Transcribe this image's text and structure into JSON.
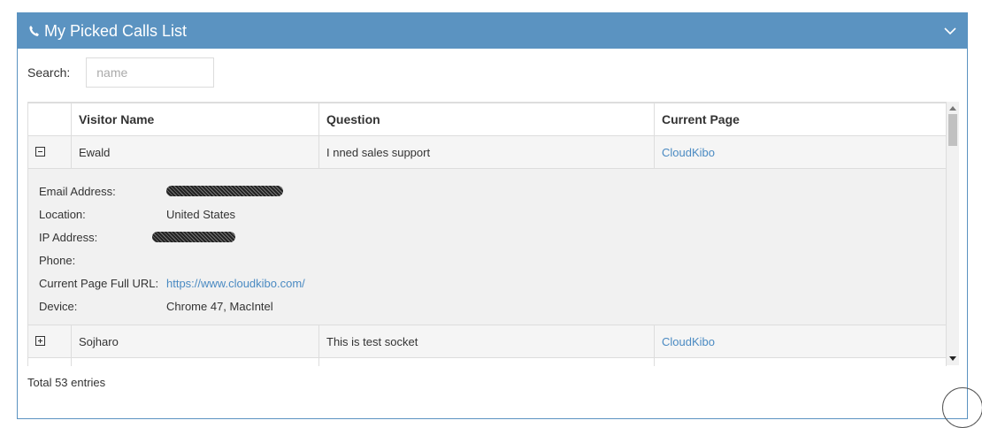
{
  "panel": {
    "title": "My Picked Calls List",
    "icons": {
      "title_icon": "phone-icon",
      "collapse": "chevron-down-icon"
    },
    "header_color": "#5b93c1"
  },
  "search": {
    "label": "Search:",
    "placeholder": "name",
    "value": ""
  },
  "table": {
    "columns": [
      "",
      "Visitor Name",
      "Question",
      "Current Page"
    ],
    "rows": [
      {
        "expanded": true,
        "visitor_name": "Ewald",
        "question": "I nned sales support",
        "current_page": "CloudKibo"
      },
      {
        "expanded": false,
        "visitor_name": "Sojharo",
        "question": "This is test socket",
        "current_page": "CloudKibo"
      }
    ],
    "details": {
      "email_label": "Email Address:",
      "location_label": "Location:",
      "location": "United States",
      "ip_label": "IP Address:",
      "phone_label": "Phone:",
      "url_label": "Current Page Full URL:",
      "url": "https://www.cloudkibo.com/",
      "device_label": "Device:",
      "device": "Chrome 47, MacIntel"
    }
  },
  "footer": {
    "total": "Total 53 entries"
  },
  "colors": {
    "link": "#4a8ac2",
    "detail_bg": "#f1f1f1",
    "stripe_bg": "#f5f5f5"
  }
}
